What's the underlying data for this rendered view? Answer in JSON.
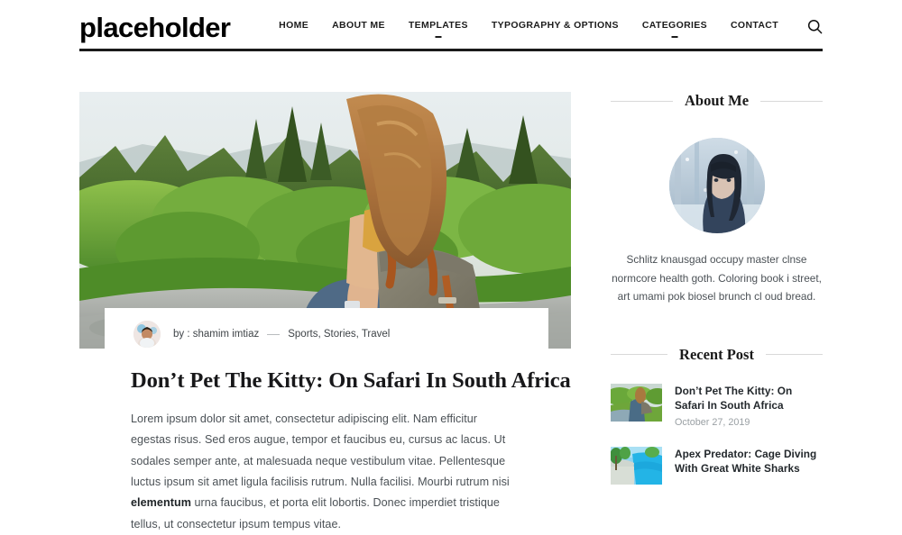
{
  "header": {
    "logo": "placeholder",
    "nav": [
      {
        "label": "HOME",
        "has_dropdown": false
      },
      {
        "label": "ABOUT ME",
        "has_dropdown": false
      },
      {
        "label": "TEMPLATES",
        "has_dropdown": true
      },
      {
        "label": "TYPOGRAPHY & OPTIONS",
        "has_dropdown": false
      },
      {
        "label": "CATEGORIES",
        "has_dropdown": true
      },
      {
        "label": "CONTACT",
        "has_dropdown": false
      }
    ],
    "search_icon": "search-icon"
  },
  "post": {
    "hero_image_alt": "woman with backpack sitting on rock looking at green forest",
    "author_prefix": "by :",
    "author": "shamim imtiaz",
    "categories": "Sports, Stories, Travel",
    "title": "Don’t Pet The Kitty: On Safari In South Africa",
    "body_part1": "Lorem ipsum dolor sit amet, consectetur adipiscing elit. Nam efficitur egestas risus. Sed eros augue, tempor et faucibus eu, cursus ac lacus. Ut sodales semper ante, at malesuada neque vestibulum vitae. Pellentesque luctus ipsum sit amet ligula facilisis rutrum. Nulla facilisi. Mourbi rutrum nisi ",
    "body_bold": "elementum",
    "body_part2": " urna faucibus, et porta elit lobortis. Donec imperdiet tristique tellus, ut consectetur ipsum tempus vitae."
  },
  "sidebar": {
    "about": {
      "title": "About Me",
      "photo_alt": "portrait of woman in winter forest",
      "text": "Schlitz knausgad occupy master clnse normcore health goth. Coloring book i street, art umami pok biosel brunch cl oud bread."
    },
    "recent": {
      "title": "Recent Post",
      "items": [
        {
          "title": "Don’t Pet The Kitty: On Safari In South Africa",
          "date": "October 27, 2019",
          "thumb_alt": "hiker by green river"
        },
        {
          "title": "Apex Predator: Cage Diving With Great White Sharks",
          "date": "",
          "thumb_alt": "blue pool and palm trees"
        }
      ]
    }
  },
  "colors": {
    "text_dark": "#1a1a1a",
    "body_text": "#4b5156",
    "muted": "#9aa0a4",
    "rule": "#d9d9d9"
  }
}
